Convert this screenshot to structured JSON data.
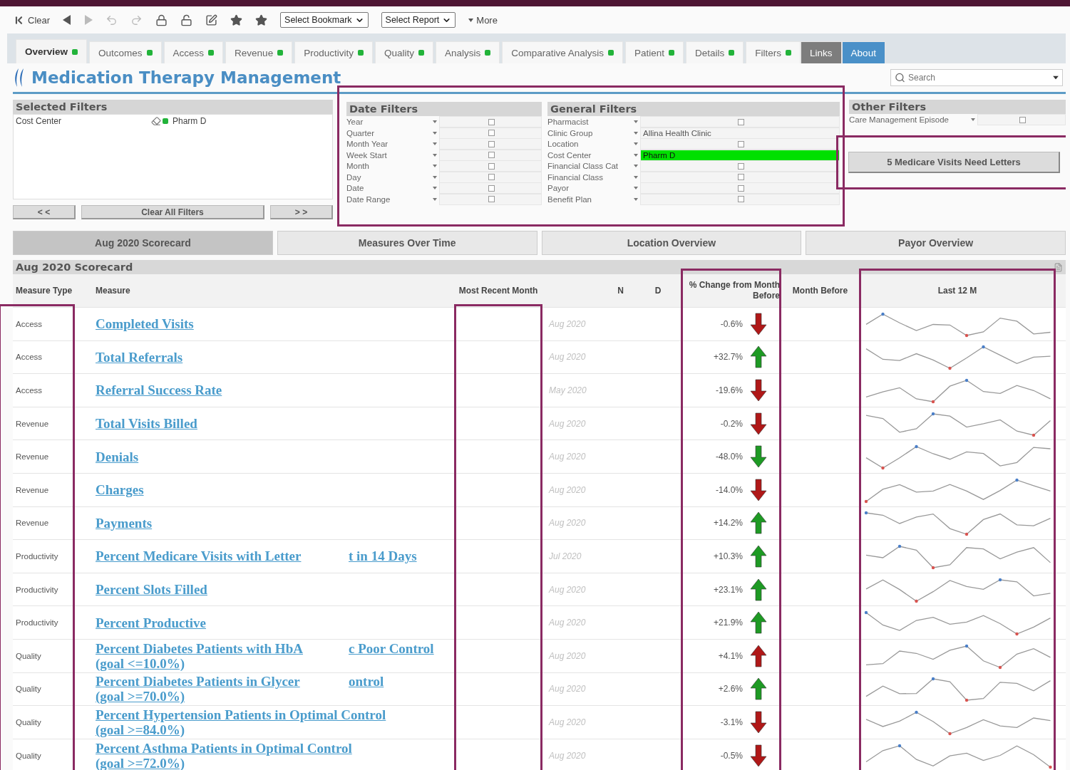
{
  "toolbar": {
    "clear": "Clear",
    "bookmark": "Select Bookmark",
    "report": "Select Report",
    "more": "More"
  },
  "tabs": [
    {
      "label": "Overview",
      "selected": true,
      "kind": "tab"
    },
    {
      "label": "Outcomes",
      "selected": false,
      "kind": "tab"
    },
    {
      "label": "Access",
      "selected": false,
      "kind": "tab"
    },
    {
      "label": "Revenue",
      "selected": false,
      "kind": "tab"
    },
    {
      "label": "Productivity",
      "selected": false,
      "kind": "tab"
    },
    {
      "label": "Quality",
      "selected": false,
      "kind": "tab"
    },
    {
      "label": "Analysis",
      "selected": false,
      "kind": "tab"
    },
    {
      "label": "Comparative Analysis",
      "selected": false,
      "kind": "tab"
    },
    {
      "label": "Patient",
      "selected": false,
      "kind": "tab"
    },
    {
      "label": "Details",
      "selected": false,
      "kind": "tab"
    },
    {
      "label": "Filters",
      "selected": false,
      "kind": "tab"
    },
    {
      "label": "Links",
      "selected": false,
      "kind": "dark"
    },
    {
      "label": "About",
      "selected": false,
      "kind": "blue"
    }
  ],
  "title": "Medication Therapy Management",
  "search": {
    "placeholder": "Search"
  },
  "selected_filters": {
    "title": "Selected Filters",
    "items": [
      {
        "field": "Cost Center",
        "value": "Pharm D"
      }
    ],
    "prev": "< <",
    "clear": "Clear All Filters",
    "next": "> >"
  },
  "date_filters": {
    "title": "Date Filters",
    "highlighted": true,
    "rows": [
      {
        "label": "Year"
      },
      {
        "label": "Quarter"
      },
      {
        "label": "Month Year"
      },
      {
        "label": "Week Start"
      },
      {
        "label": "Month"
      },
      {
        "label": "Day"
      },
      {
        "label": "Date"
      },
      {
        "label": "Date Range"
      }
    ]
  },
  "general_filters": {
    "title": "General Filters",
    "rows": [
      {
        "label": "Pharmacist"
      },
      {
        "label": "Clinic Group",
        "value": "Allina Health Clinic",
        "selected": false
      },
      {
        "label": "Location"
      },
      {
        "label": "Cost Center",
        "value": "Pharm D",
        "selected": true
      },
      {
        "label": "Financial Class Cat"
      },
      {
        "label": "Financial Class"
      },
      {
        "label": "Payor"
      },
      {
        "label": "Benefit Plan"
      }
    ]
  },
  "other_filters": {
    "title": "Other Filters",
    "rows": [
      {
        "label": "Care Management Episode"
      }
    ]
  },
  "alert_button": {
    "label": "5 Medicare Visits Need Letters",
    "highlighted": true
  },
  "view_tabs": [
    {
      "label": "Aug 2020 Scorecard",
      "selected": true
    },
    {
      "label": "Measures Over Time",
      "selected": false
    },
    {
      "label": "Location Overview",
      "selected": false
    },
    {
      "label": "Payor Overview",
      "selected": false
    }
  ],
  "scorecard": {
    "title": "Aug 2020 Scorecard",
    "columns": [
      {
        "label": "Measure Type",
        "highlighted": true
      },
      {
        "label": "Measure",
        "highlighted": false
      },
      {
        "label": "Most Recent Month",
        "highlighted": true
      },
      {
        "highlighted": false
      },
      {
        "label": "N",
        "highlighted": false
      },
      {
        "label": "D",
        "highlighted": false
      },
      {
        "label": "% Change from Month Before",
        "highlighted": true
      },
      {
        "label": "Month Before",
        "highlighted": false
      },
      {
        "label": "Last 12 M",
        "highlighted": true
      }
    ],
    "rows": [
      {
        "type": "Access",
        "measure": [
          [
            "Completed Visits"
          ]
        ],
        "month": "Aug 2020",
        "change": "-0.6%",
        "increase": false,
        "good": false
      },
      {
        "type": "Access",
        "measure": [
          [
            "Total Referrals"
          ]
        ],
        "month": "Aug 2020",
        "change": "+32.7%",
        "increase": true,
        "good": true
      },
      {
        "type": "Access",
        "measure": [
          [
            "Referral Success Rate"
          ]
        ],
        "month": "May 2020",
        "change": "-19.6%",
        "increase": false,
        "good": false
      },
      {
        "type": "Revenue",
        "measure": [
          [
            "Total Visits Billed"
          ]
        ],
        "month": "Aug 2020",
        "change": "-0.2%",
        "increase": false,
        "good": false
      },
      {
        "type": "Revenue",
        "measure": [
          [
            "Denials"
          ]
        ],
        "month": "Aug 2020",
        "change": "-48.0%",
        "increase": false,
        "good": true
      },
      {
        "type": "Revenue",
        "measure": [
          [
            "Charges"
          ]
        ],
        "month": "Aug 2020",
        "change": "-14.0%",
        "increase": false,
        "good": false
      },
      {
        "type": "Revenue",
        "measure": [
          [
            "Payments"
          ]
        ],
        "month": "Aug 2020",
        "change": "+14.2%",
        "increase": true,
        "good": true
      },
      {
        "type": "Productivity",
        "measure": [
          [
            "Percent Medicare Visits with Letter",
            "t in 14 Days"
          ]
        ],
        "month": "Jul 2020",
        "change": "+10.3%",
        "increase": true,
        "good": true
      },
      {
        "type": "Productivity",
        "measure": [
          [
            "Percent Slots Filled"
          ]
        ],
        "month": "Aug 2020",
        "change": "+23.1%",
        "increase": true,
        "good": true
      },
      {
        "type": "Productivity",
        "measure": [
          [
            "Percent Productive"
          ]
        ],
        "month": "Aug 2020",
        "change": "+21.9%",
        "increase": true,
        "good": true
      },
      {
        "type": "Quality",
        "measure": [
          [
            "Percent Diabetes Patients with HbA",
            "c Poor Control"
          ],
          [
            "(goal <=10.0%)"
          ]
        ],
        "month": "Aug 2020",
        "change": "+4.1%",
        "increase": true,
        "good": false
      },
      {
        "type": "Quality",
        "measure": [
          [
            "Percent Diabetes Patients in Glycer",
            "ontrol"
          ],
          [
            "(goal >=70.0%)"
          ]
        ],
        "month": "Aug 2020",
        "change": "+2.6%",
        "increase": true,
        "good": true
      },
      {
        "type": "Quality",
        "measure": [
          [
            "Percent Hypertension Patients in Optimal Control"
          ],
          [
            "(goal >=84.0%)"
          ]
        ],
        "month": "Aug 2020",
        "change": "-3.1%",
        "increase": false,
        "good": false
      },
      {
        "type": "Quality",
        "measure": [
          [
            "Percent Asthma Patients in Optimal Control"
          ],
          [
            "(goal >=72.0%)"
          ]
        ],
        "month": "Aug 2020",
        "change": "-0.5%",
        "increase": false,
        "good": false
      }
    ]
  }
}
